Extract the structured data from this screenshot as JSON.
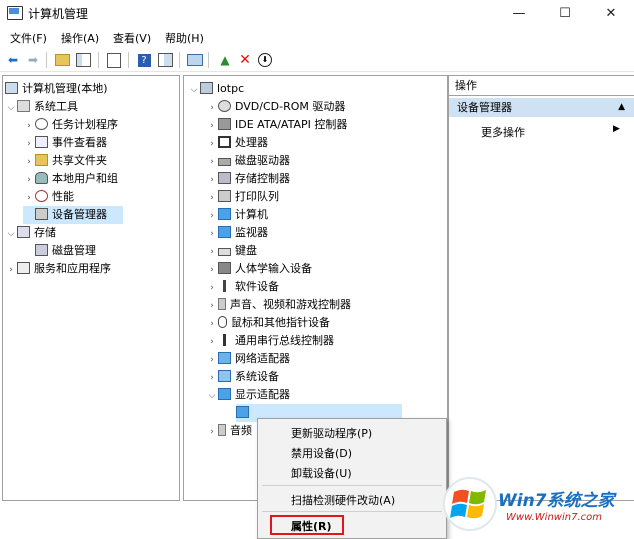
{
  "window": {
    "title": "计算机管理",
    "controls": [
      "—",
      "☐",
      "✕"
    ]
  },
  "menubar": [
    "文件(F)",
    "操作(A)",
    "查看(V)",
    "帮助(H)"
  ],
  "left_tree": {
    "root": "计算机管理(本地)",
    "system_tools": "系统工具",
    "items": [
      "任务计划程序",
      "事件查看器",
      "共享文件夹",
      "本地用户和组",
      "性能",
      "设备管理器"
    ],
    "storage": "存储",
    "disk_mgmt": "磁盘管理",
    "services": "服务和应用程序"
  },
  "device_tree": {
    "root": "lotpc",
    "items": [
      "DVD/CD-ROM 驱动器",
      "IDE ATA/ATAPI 控制器",
      "处理器",
      "磁盘驱动器",
      "存储控制器",
      "打印队列",
      "计算机",
      "监视器",
      "键盘",
      "人体学输入设备",
      "软件设备",
      "声音、视频和游戏控制器",
      "鼠标和其他指针设备",
      "通用串行总线控制器",
      "网络适配器",
      "系统设备",
      "显示适配器"
    ],
    "partial": "音频"
  },
  "actions": {
    "header": "操作",
    "section": "设备管理器",
    "more": "更多操作"
  },
  "context_menu": {
    "update_driver": "更新驱动程序(P)",
    "disable": "禁用设备(D)",
    "uninstall": "卸载设备(U)",
    "scan": "扫描检测硬件改动(A)",
    "properties": "属性(R)"
  },
  "watermark": {
    "brand": "Win7系统之家",
    "url": "Www.Winwin7.com"
  },
  "colors": {
    "selection": "#cce8ff",
    "highlight_box": "#e0161b",
    "action_band": "#cfe2f3"
  }
}
